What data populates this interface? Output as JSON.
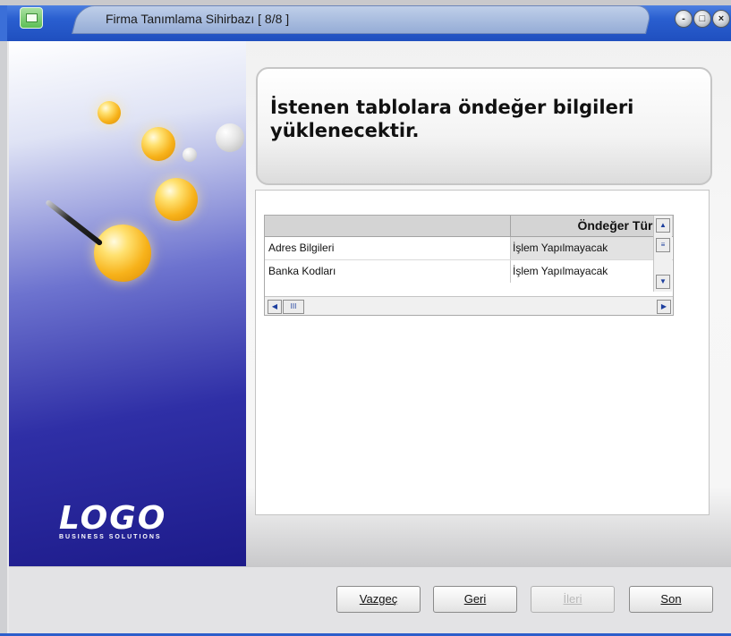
{
  "window": {
    "title": "Firma Tanımlama Sihirbazı [ 8/8 ]",
    "controls": {
      "minimize": "-",
      "maximize": "□",
      "close": "×"
    }
  },
  "logo": {
    "text": "LOGO",
    "subtext": "BUSINESS SOLUTIONS"
  },
  "heading": {
    "text": "İstenen tablolara öndeğer bilgileri yüklenecektir."
  },
  "table": {
    "columns": [
      "",
      "Öndeğer Türü"
    ],
    "rows": [
      {
        "name": "Adres Bilgileri",
        "value": "İşlem Yapılmayacak"
      },
      {
        "name": "Banka Kodları",
        "value": "İşlem Yapılmayacak"
      }
    ],
    "scroll_up": "▲",
    "scroll_down": "▼",
    "scroll_left": "◀",
    "scroll_right": "▶",
    "scroll_thumb": "≡",
    "scroll_thumb_h": "III"
  },
  "buttons": {
    "cancel": "Vazgeç",
    "back": "Geri",
    "next": "İleri",
    "finish": "Son"
  },
  "colors": {
    "titlebar": "#2a5fd0",
    "panel_blue": "#1d1b8a",
    "orb": "#f7b21a"
  }
}
